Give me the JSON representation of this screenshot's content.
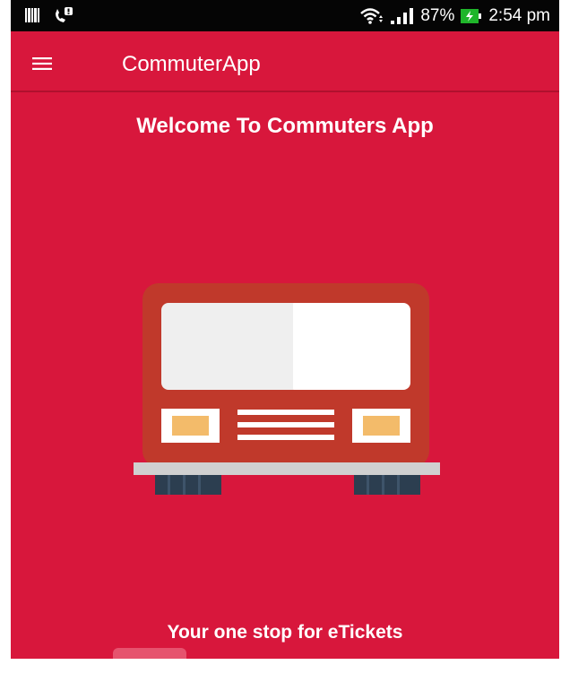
{
  "status_bar": {
    "battery": "87%",
    "time": "2:54 pm",
    "icons": [
      "barcode-icon",
      "missed-call-icon",
      "wifi-icon",
      "signal-icon",
      "battery-charging-icon"
    ]
  },
  "app_bar": {
    "title": "CommuterApp",
    "menu_icon": "hamburger-menu-icon"
  },
  "main": {
    "welcome": "Welcome To Commuters App",
    "illustration": "bus-icon",
    "tagline": "Your one stop for eTickets"
  },
  "colors": {
    "primary": "#d8173c",
    "bus_body": "#c0392b",
    "bus_window_left": "#efefef",
    "bus_window_right": "#ffffff",
    "headlight": "#f3bb6a",
    "bumper": "#d0d0d0",
    "wheels": "#2c3e50",
    "status_bar": "#050505"
  }
}
